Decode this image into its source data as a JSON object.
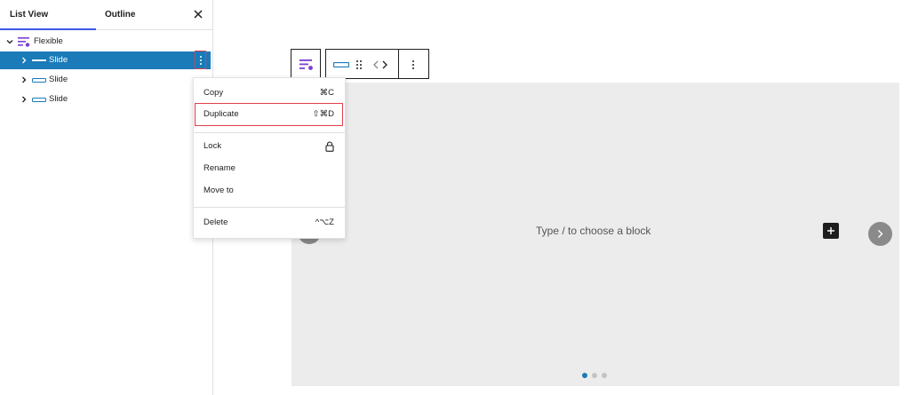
{
  "list_view": {
    "tabs": {
      "list_view": "List View",
      "outline": "Outline"
    },
    "close_icon": "close-icon",
    "tree": {
      "root": {
        "label": "Flexible",
        "icon": "flexible-block-icon",
        "expanded": true
      },
      "items": [
        {
          "label": "Slide",
          "icon": "slide-block-icon",
          "selected": true
        },
        {
          "label": "Slide",
          "icon": "slide-block-icon",
          "selected": false
        },
        {
          "label": "Slide",
          "icon": "slide-block-icon",
          "selected": false
        }
      ]
    }
  },
  "context_menu": {
    "groups": [
      [
        {
          "label": "Copy",
          "shortcut": "⌘C"
        },
        {
          "label": "Duplicate",
          "shortcut": "⇧⌘D",
          "highlighted": true
        }
      ],
      [
        {
          "label": "Lock",
          "icon": "lock-icon"
        },
        {
          "label": "Rename"
        },
        {
          "label": "Move to"
        }
      ],
      [
        {
          "label": "Delete",
          "shortcut": "^⌥Z"
        }
      ]
    ]
  },
  "editor": {
    "placeholder": "Type / to choose a block",
    "carousel_dots": {
      "count": 3,
      "active": 0
    }
  },
  "colors": {
    "selection": "#1b7ab8",
    "accent_purple": "#7b3fd0",
    "highlight_red": "#e0404a",
    "active_dot": "#1b7ab8"
  }
}
